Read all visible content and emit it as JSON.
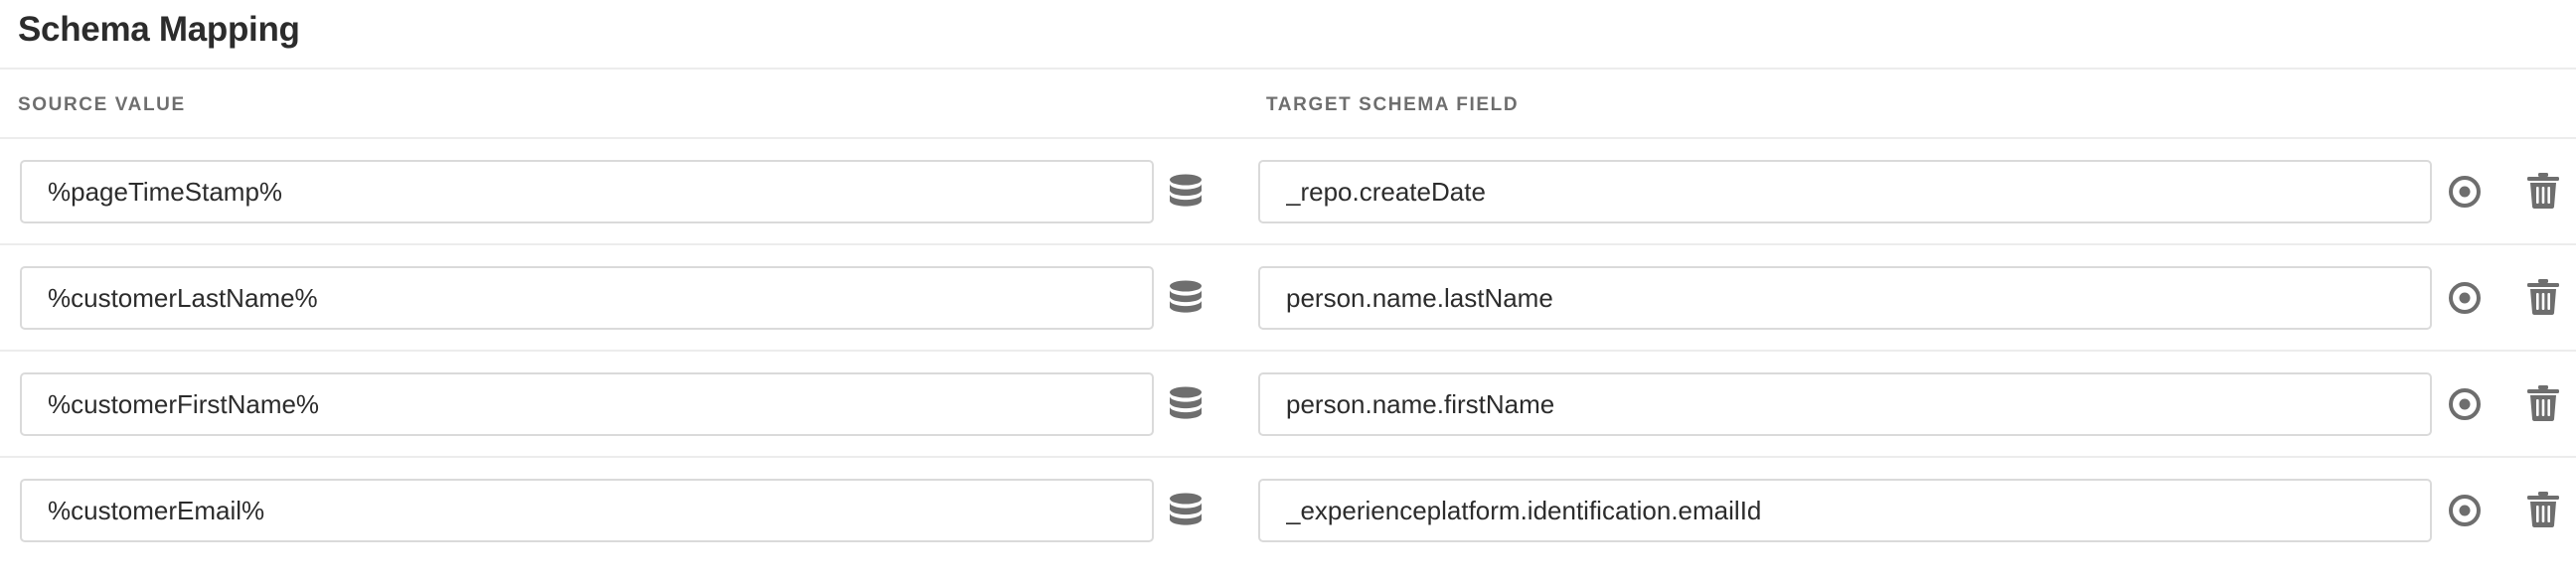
{
  "header": {
    "title": "Schema Mapping"
  },
  "columns": {
    "source": "SOURCE VALUE",
    "target": "TARGET SCHEMA FIELD"
  },
  "icons": {
    "data_element": "database-icon",
    "select_target": "target-icon",
    "delete": "trash-icon"
  },
  "colors": {
    "icon": "#6e6e6e",
    "border": "#dadada",
    "divider": "#ececec",
    "text": "#2c2c2c"
  },
  "rows": [
    {
      "source": "%pageTimeStamp%",
      "target": "_repo.createDate"
    },
    {
      "source": "%customerLastName%",
      "target": "person.name.lastName"
    },
    {
      "source": "%customerFirstName%",
      "target": "person.name.firstName"
    },
    {
      "source": "%customerEmail%",
      "target": "_experienceplatform.identification.emailId"
    }
  ]
}
